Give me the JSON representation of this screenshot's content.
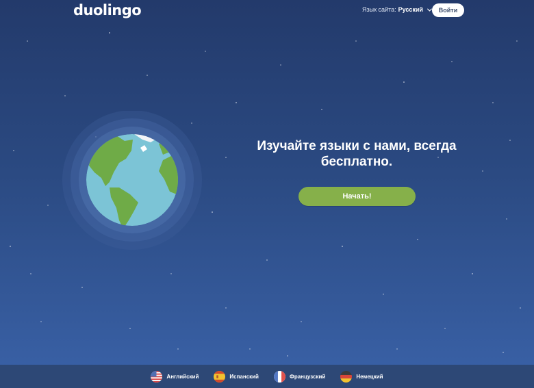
{
  "header": {
    "logo_text": "duolingo",
    "site_language_label": "Язык сайта:",
    "site_language_value": "Русский",
    "login_label": "Войти"
  },
  "hero": {
    "headline_line1": "Изучайте языки с нами, всегда",
    "headline_line2": "бесплатно.",
    "start_label": "Начать!"
  },
  "footer": {
    "courses": [
      {
        "label": "Английский",
        "flag_icon": "us-flag-icon"
      },
      {
        "label": "Испанский",
        "flag_icon": "spain-flag-icon"
      },
      {
        "label": "Французский",
        "flag_icon": "france-flag-icon"
      },
      {
        "label": "Немецкий",
        "flag_icon": "germany-flag-icon"
      }
    ]
  },
  "colors": {
    "background_top": "#233a6b",
    "background_bottom": "#3a62a8",
    "footer_bg": "#2d4876",
    "start_button": "#86b04a",
    "ocean": "#7cc4d6",
    "land": "#6fab47"
  }
}
